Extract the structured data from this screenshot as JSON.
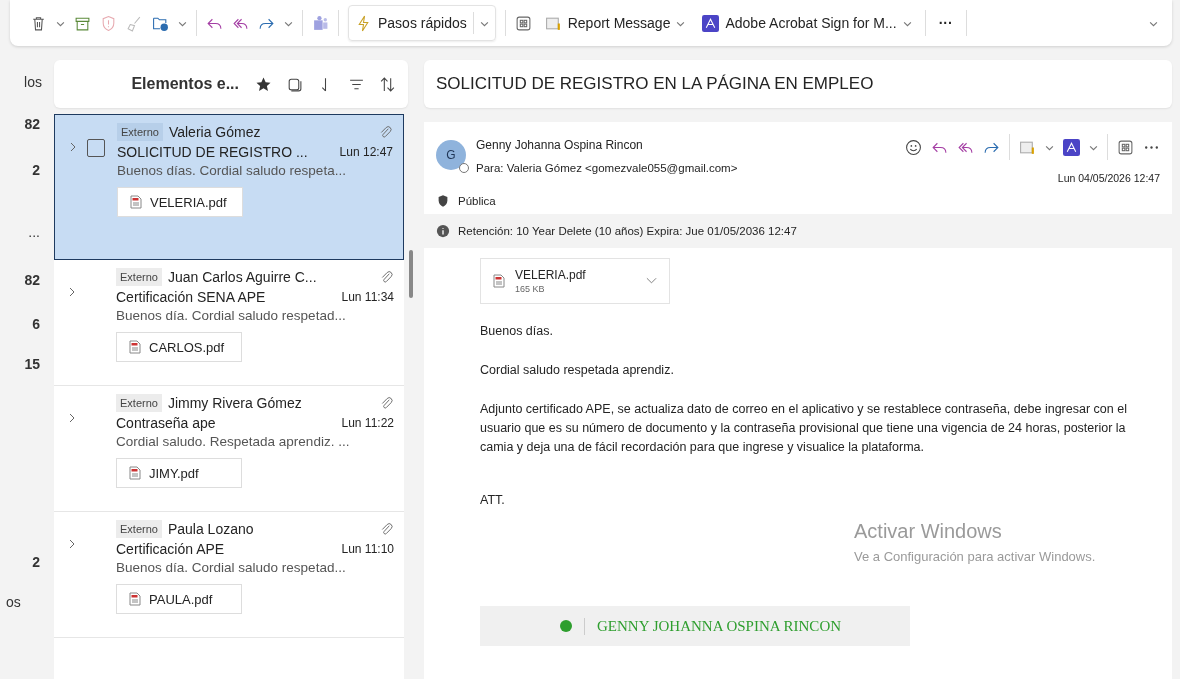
{
  "toolbar": {
    "quick_steps": "Pasos rápidos",
    "report": "Report Message",
    "acrobat": "Adobe Acrobat Sign for M...",
    "more": "···"
  },
  "folder_rail": [
    "los",
    "82",
    "2",
    "...",
    "82",
    "6",
    "15",
    "2",
    "os"
  ],
  "message_list": {
    "title": "Elementos e...",
    "messages": [
      {
        "tag": "Externo",
        "sender": "Valeria Gómez",
        "subject": "SOLICITUD DE REGISTRO ...",
        "time": "Lun 12:47",
        "preview": "Buenos días. Cordial saludo respeta...",
        "attachment": "VELERIA.pdf",
        "selected": true
      },
      {
        "tag": "Externo",
        "sender": "Juan Carlos Aguirre C...",
        "subject": "Certificación SENA APE",
        "time": "Lun 11:34",
        "preview": "Buenos día. Cordial saludo respetad...",
        "attachment": "CARLOS.pdf",
        "selected": false
      },
      {
        "tag": "Externo",
        "sender": "Jimmy Rivera Gómez",
        "subject": "Contraseña ape",
        "time": "Lun 11:22",
        "preview": "Cordial saludo. Respetada aprendiz. ...",
        "attachment": "JIMY.pdf",
        "selected": false
      },
      {
        "tag": "Externo",
        "sender": "Paula Lozano",
        "subject": "Certificación APE",
        "time": "Lun 11:10",
        "preview": "Buenos día. Cordial saludo respetad...",
        "attachment": "PAULA.pdf",
        "selected": false
      }
    ]
  },
  "reading_pane": {
    "subject": "SOLICITUD DE REGISTRO EN LA PÁGINA EN EMPLEO",
    "avatar": "G",
    "from": "Genny Johanna Ospina Rincon",
    "to": "Para:  Valeria Gómez <gomezvale055@gmail.com>",
    "date": "Lun 04/05/2026 12:47",
    "sensitivity": "Pública",
    "retention": "Retención: 10 Year Delete (10 años) Expira: Jue 01/05/2036 12:47",
    "attachment": {
      "name": "VELERIA.pdf",
      "size": "165 KB"
    },
    "body": [
      "Buenos días.",
      "Cordial saludo respetada aprendiz.",
      "Adjunto certificado APE, se actualiza dato de correo en el aplicativo y se restablece contraseña, debe ingresar con el usuario que es su número de documento y la contraseña provisional que tiene una vigencia de 24 horas, posterior la camia y deja una de fácil recordación para que ingrese y visualice la plataforma.",
      "ATT."
    ],
    "signature": "GENNY JOHANNA OSPINA RINCON"
  },
  "system_notice": {
    "title": "Activar Windows",
    "text": "Ve a Configuración para activar Windows."
  }
}
